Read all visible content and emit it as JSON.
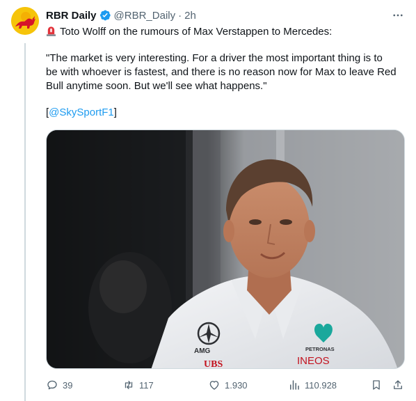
{
  "author": {
    "display_name": "RBR Daily",
    "handle": "@RBR_Daily",
    "separator": "·",
    "time": "2h"
  },
  "tweet": {
    "line1": "Toto Wolff on the rumours of Max Verstappen to Mercedes:",
    "quote_line1": "\"The market is very interesting. For a driver the most important thing is to",
    "quote_line2": "be with whoever is fastest, and there is no reason now for Max to leave Red",
    "quote_line3": "Bull anytime soon. But we'll see what happens.\"",
    "source_open": "[",
    "source_mention": "@SkySportF1",
    "source_close": "]"
  },
  "photo": {
    "shirt_brand_1": "AMG",
    "shirt_brand_2": "UBS",
    "shirt_brand_3": "PETRONAS",
    "shirt_brand_4": "INEOS"
  },
  "actions": {
    "replies": "39",
    "reposts": "117",
    "likes": "1.930",
    "views": "110.928"
  },
  "colors": {
    "accent": "#1d9bf0",
    "muted": "#536471",
    "verified": "#1d9bf0",
    "avatar_bg": "#f6c40a"
  }
}
